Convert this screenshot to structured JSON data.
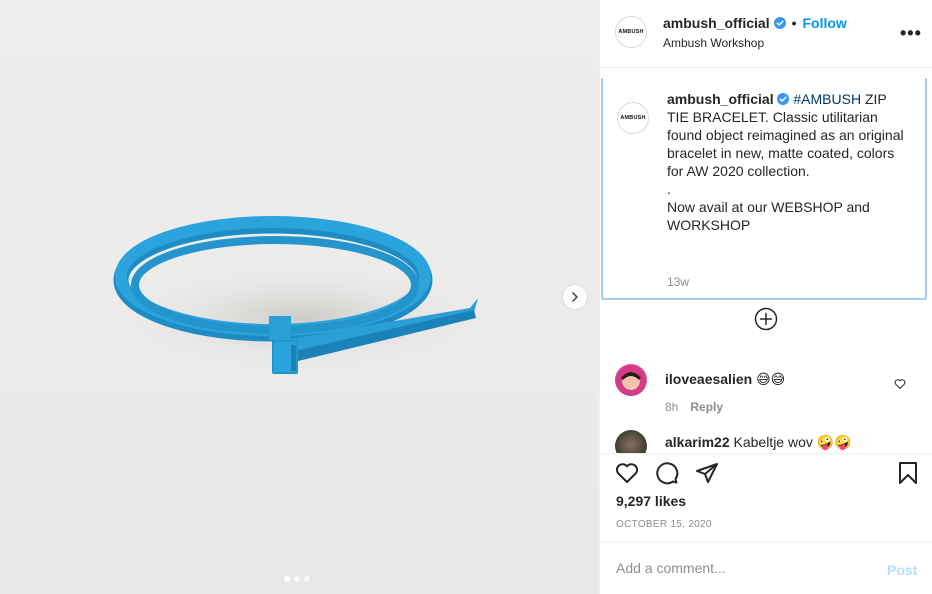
{
  "post": {
    "author": "ambush_official",
    "logo_text": "AMBUSH",
    "follow_label": "Follow",
    "separator": "•",
    "location": "Ambush Workshop",
    "more_label": "•••"
  },
  "caption": {
    "username": "ambush_official",
    "hashtag": "#AMBUSH",
    "line1": " ZIP TIE BRACELET. Classic utilitarian found object reimagined as an original bracelet in new, matte coated, colors for AW 2020 collection.",
    "dot": ".",
    "line2": "Now avail at our WEBSHOP and WORKSHOP",
    "time": "13w"
  },
  "comments": [
    {
      "username": "iloveaesalien",
      "text": "😅😅",
      "time": "8h",
      "reply_label": "Reply"
    },
    {
      "username": "alkarim22",
      "text": "Kabeltje wov 🤪🤪"
    }
  ],
  "engagement": {
    "likes": "9,297 likes",
    "date": "OCTOBER 15, 2020"
  },
  "add_comment": {
    "placeholder": "Add a comment...",
    "post_label": "Post"
  },
  "media": {
    "image_count": 3,
    "current_index": 0
  },
  "colors": {
    "accent": "#0095f6",
    "bracelet": "#2a9fd6",
    "verified": "#3897f0"
  },
  "icons": [
    "heart-icon",
    "comment-icon",
    "share-icon",
    "bookmark-icon",
    "chevron-right-icon",
    "plus-circle-icon"
  ]
}
